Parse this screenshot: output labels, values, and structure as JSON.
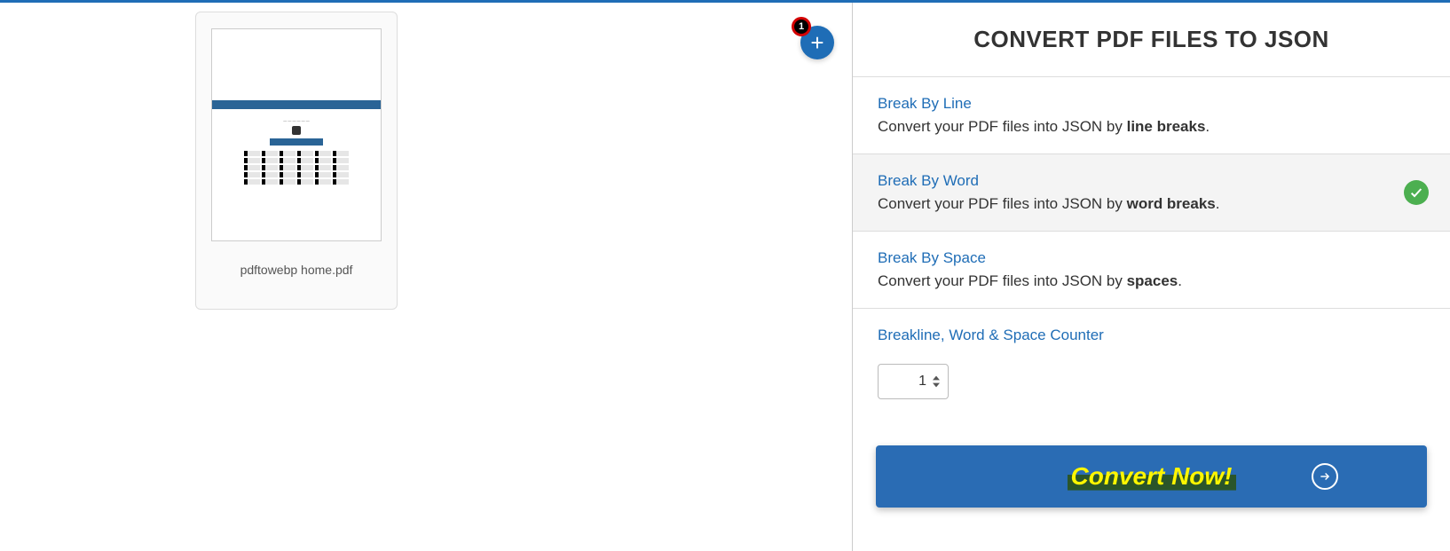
{
  "files": {
    "items": [
      {
        "name": "pdftowebp home.pdf"
      }
    ],
    "add_badge_count": "1"
  },
  "panel": {
    "title": "CONVERT PDF FILES TO JSON",
    "options": [
      {
        "title": "Break By Line",
        "desc_prefix": "Convert your PDF files into JSON by ",
        "desc_bold": "line breaks",
        "desc_suffix": ".",
        "active": false
      },
      {
        "title": "Break By Word",
        "desc_prefix": "Convert your PDF files into JSON by ",
        "desc_bold": "word breaks",
        "desc_suffix": ".",
        "active": true
      },
      {
        "title": "Break By Space",
        "desc_prefix": "Convert your PDF files into JSON by ",
        "desc_bold": "spaces",
        "desc_suffix": ".",
        "active": false
      }
    ],
    "counter": {
      "label": "Breakline, Word & Space Counter",
      "value": "1"
    },
    "convert_label": "Convert Now!"
  }
}
